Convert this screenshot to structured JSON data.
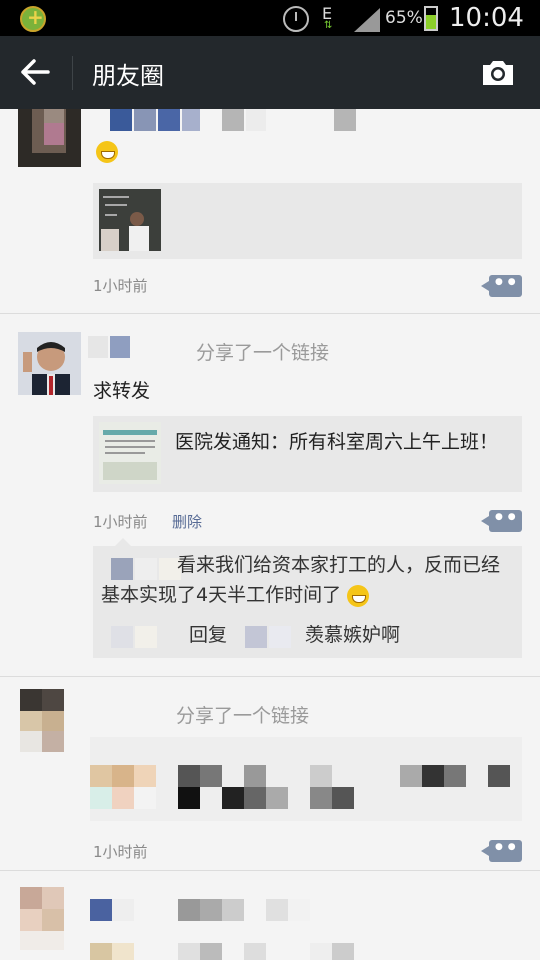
{
  "status_bar": {
    "network": "E",
    "battery_percent": "65%",
    "time": "10:04",
    "icons": [
      "app-icon",
      "alarm-icon",
      "signal-icon",
      "battery-icon"
    ]
  },
  "title_bar": {
    "title": "朋友圈",
    "back_icon": "back-arrow-icon",
    "camera_icon": "camera-icon"
  },
  "posts": [
    {
      "time": "1小时前",
      "has_emoji": true
    },
    {
      "share_label": "分享了一个链接",
      "text": "求转发",
      "link_title": "医院发通知：所有科室周六上午上班！",
      "time": "1小时前",
      "delete_label": "删除",
      "comments": [
        {
          "text": "看来我们给资本家打工的人，反而已经基本实现了4天半工作时间了"
        },
        {
          "reply_label": "回复",
          "text": "羡慕嫉妒啊"
        }
      ]
    },
    {
      "share_label": "分享了一个链接",
      "time": "1小时前"
    },
    {}
  ],
  "colors": {
    "title_bar": "#23282c",
    "link_blue": "#576b95",
    "comment_button": "#8090a8",
    "background": "#f4f4f4"
  }
}
